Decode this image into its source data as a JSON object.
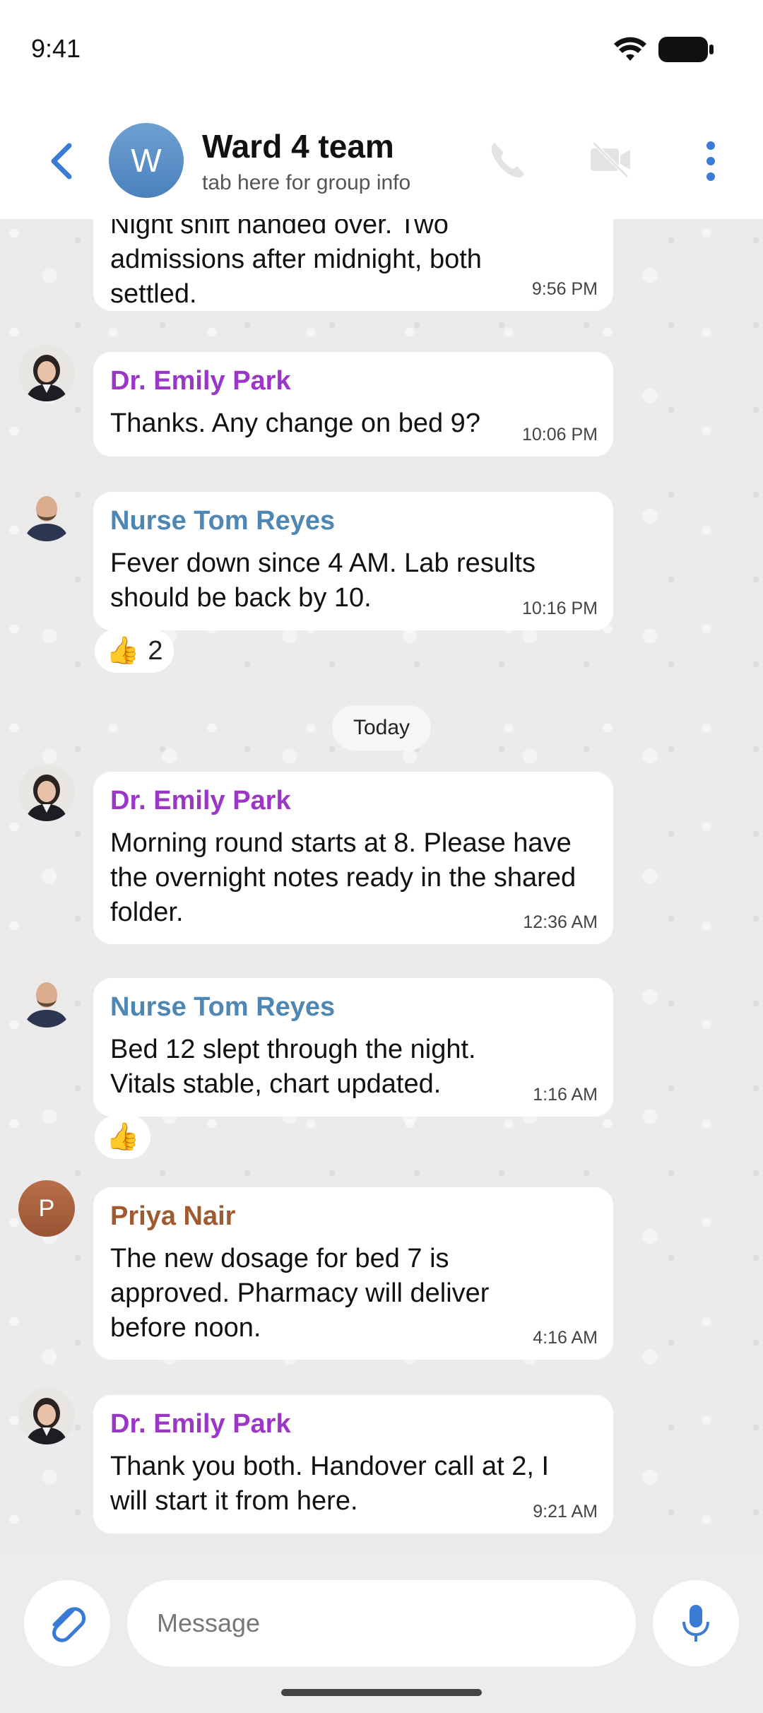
{
  "status_bar": {
    "time": "9:41"
  },
  "header": {
    "avatar_letter": "W",
    "title": "Ward 4 team",
    "subtitle": "tab here for group info"
  },
  "colors": {
    "accent": "#3a7bd5",
    "emily": "#9b36c7",
    "tom": "#4e86b4",
    "priya": "#a05a30"
  },
  "messages": [
    {
      "text": "Night shift handed over. Two admissions after midnight, both settled.",
      "time": "9:56 PM"
    },
    {
      "sender": "Dr. Emily Park",
      "text": "Thanks. Any change on bed 9?",
      "time": "10:06 PM"
    },
    {
      "sender": "Nurse Tom Reyes",
      "text": "Fever down since 4 AM. Lab results should be back by 10.",
      "time": "10:16 PM",
      "reaction": "👍",
      "reaction_count": "2"
    },
    {
      "sender": "Dr. Emily Park",
      "text": "Morning round starts at 8. Please have the overnight notes ready in the shared folder.",
      "time": "12:36 AM"
    },
    {
      "sender": "Nurse Tom Reyes",
      "text": "Bed 12 slept through the night. Vitals stable, chart updated.",
      "time": "1:16 AM",
      "reaction": "👍"
    },
    {
      "sender": "Priya Nair",
      "avatar_letter": "P",
      "text": "The new dosage for bed 7 is approved. Pharmacy will deliver before noon.",
      "time": "4:16 AM"
    },
    {
      "sender": "Dr. Emily Park",
      "text": "Thank you both. Handover call at 2, I will start it from here.",
      "time": "9:21 AM"
    }
  ],
  "date_divider": "Today",
  "composer": {
    "placeholder": "Message"
  }
}
